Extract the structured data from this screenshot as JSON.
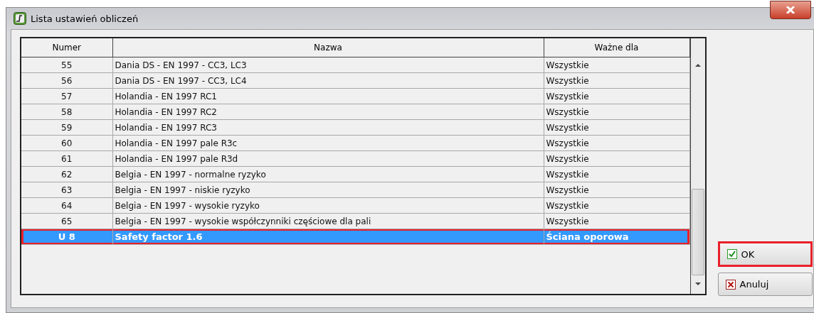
{
  "window": {
    "title": "Lista ustawień obliczeń"
  },
  "table": {
    "columns": [
      "Numer",
      "Nazwa",
      "Ważne dla"
    ],
    "rows": [
      {
        "cells": [
          "55",
          "Dania DS - EN 1997 - CC3, LC3",
          "Wszystkie"
        ],
        "selected": false,
        "highlighted": false
      },
      {
        "cells": [
          "56",
          "Dania DS - EN 1997 - CC3, LC4",
          "Wszystkie"
        ],
        "selected": false,
        "highlighted": false
      },
      {
        "cells": [
          "57",
          "Holandia - EN 1997  RC1",
          "Wszystkie"
        ],
        "selected": false,
        "highlighted": false
      },
      {
        "cells": [
          "58",
          "Holandia - EN 1997  RC2",
          "Wszystkie"
        ],
        "selected": false,
        "highlighted": false
      },
      {
        "cells": [
          "59",
          "Holandia - EN 1997  RC3",
          "Wszystkie"
        ],
        "selected": false,
        "highlighted": false
      },
      {
        "cells": [
          "60",
          "Holandia - EN 1997  pale R3c",
          "Wszystkie"
        ],
        "selected": false,
        "highlighted": false
      },
      {
        "cells": [
          "61",
          "Holandia - EN 1997  pale R3d",
          "Wszystkie"
        ],
        "selected": false,
        "highlighted": false
      },
      {
        "cells": [
          "62",
          "Belgia - EN 1997 - normalne ryzyko",
          "Wszystkie"
        ],
        "selected": false,
        "highlighted": false
      },
      {
        "cells": [
          "63",
          "Belgia - EN 1997 - niskie ryzyko",
          "Wszystkie"
        ],
        "selected": false,
        "highlighted": false
      },
      {
        "cells": [
          "64",
          "Belgia - EN 1997 - wysokie ryzyko",
          "Wszystkie"
        ],
        "selected": false,
        "highlighted": false
      },
      {
        "cells": [
          "65",
          "Belgia - EN 1997 - wysokie współczynniki częściowe dla pali",
          "Wszystkie"
        ],
        "selected": false,
        "highlighted": false
      },
      {
        "cells": [
          "U 8",
          "Safety factor 1.6",
          "Ściana oporowa"
        ],
        "selected": true,
        "highlighted": true
      }
    ]
  },
  "buttons": [
    {
      "kind": "ok",
      "label": "OK",
      "highlighted": true
    },
    {
      "kind": "cancel",
      "label": "Anuluj",
      "highlighted": false
    }
  ]
}
